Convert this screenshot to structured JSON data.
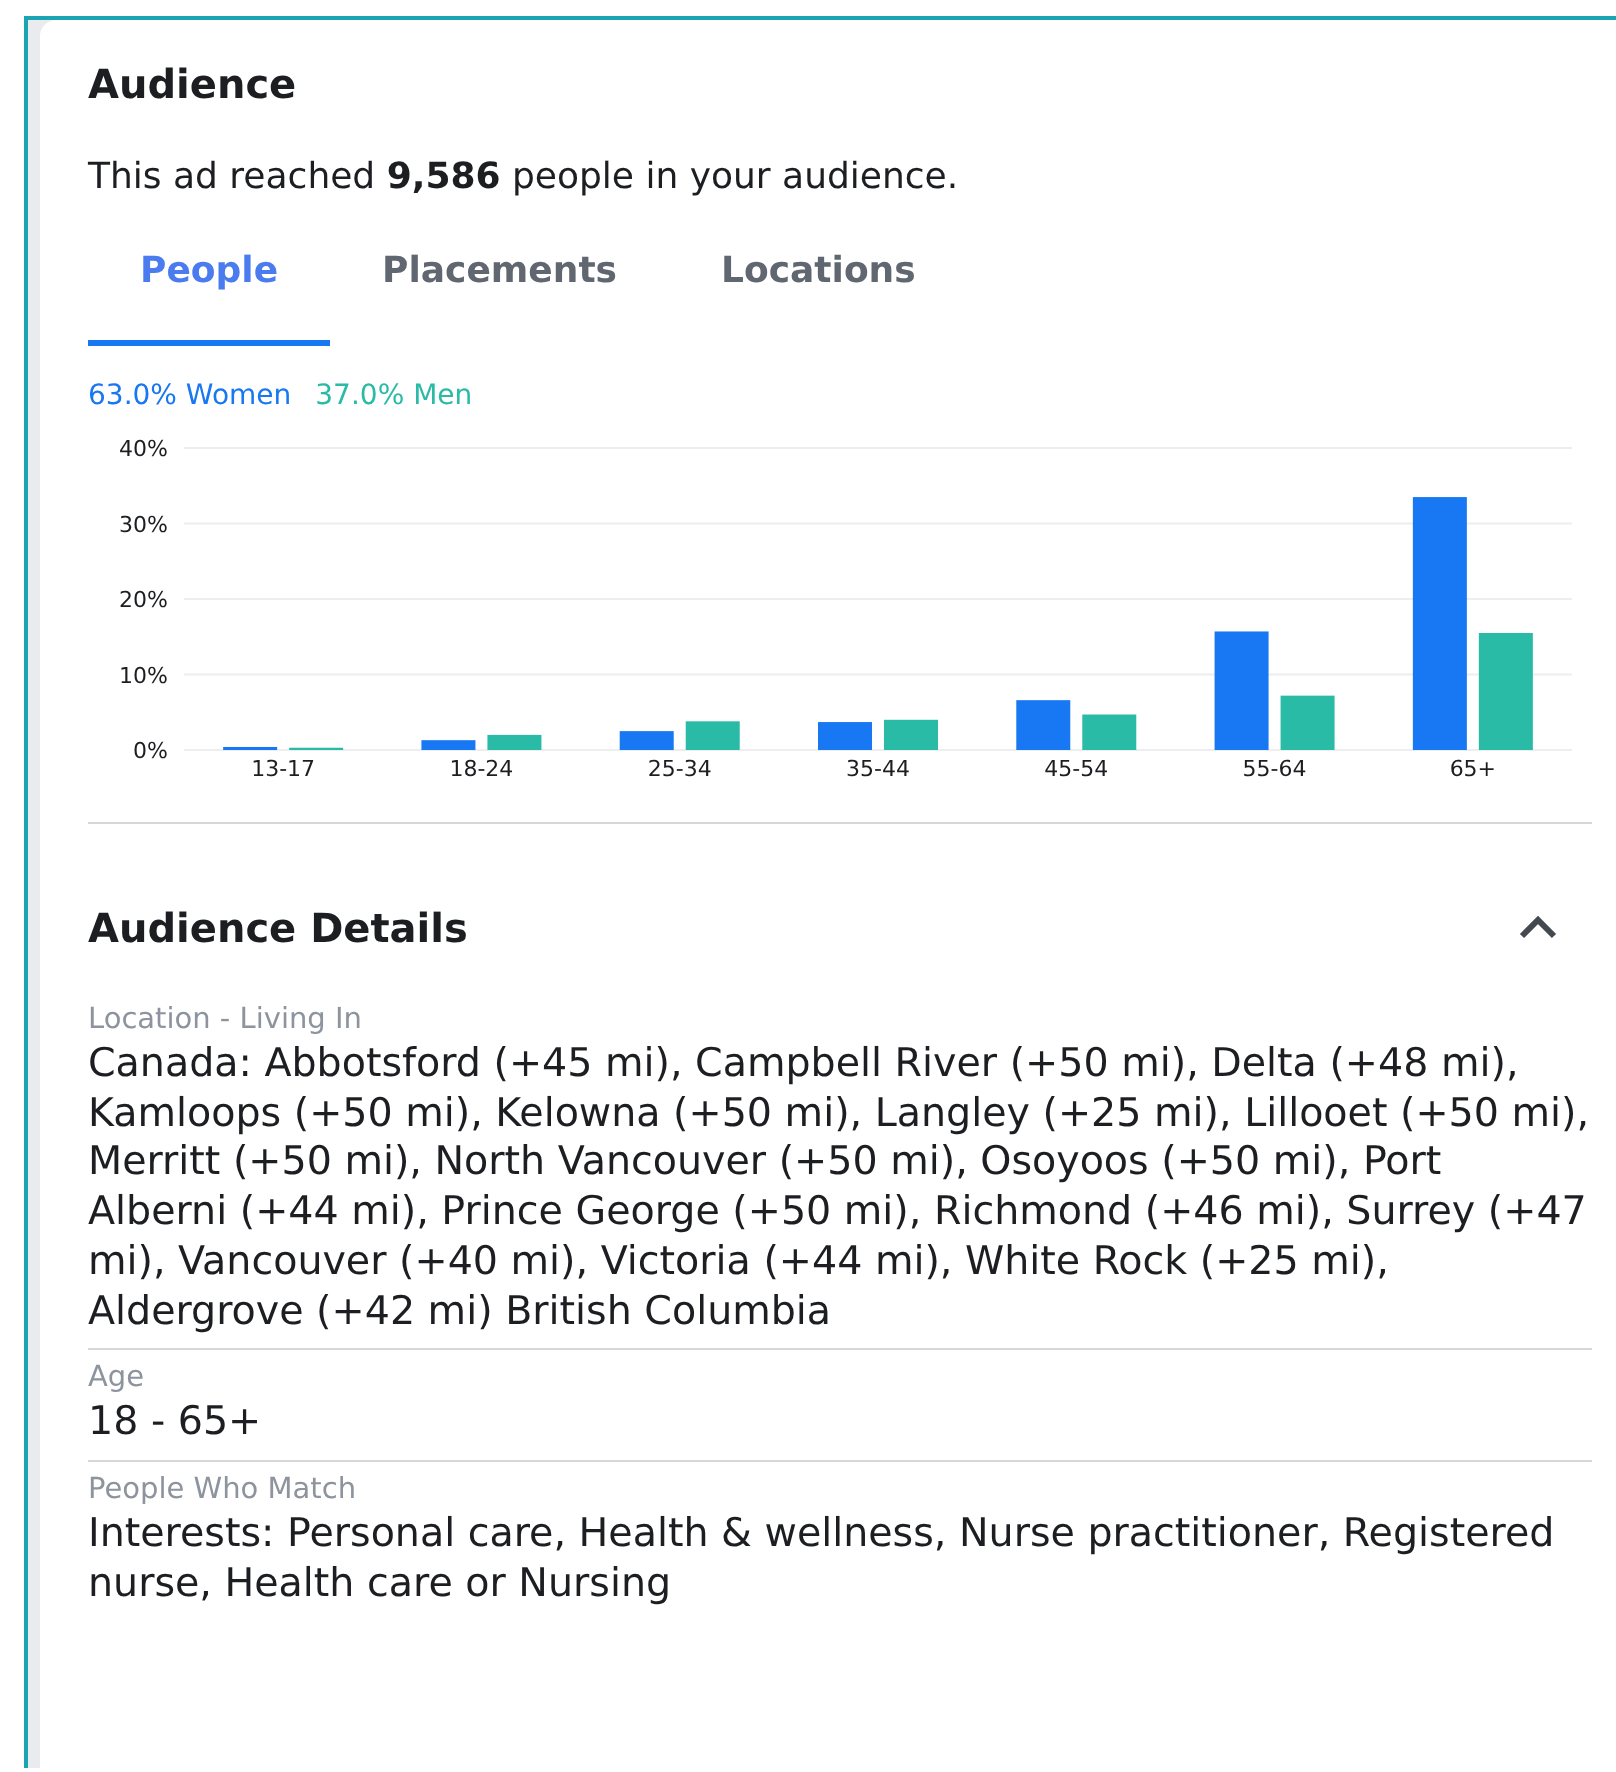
{
  "title": "Audience",
  "summary": "This ad reached **9,586** people in your audience.",
  "tabs": [
    {
      "label": "People",
      "selected": true
    },
    {
      "label": "Placements",
      "selected": false
    },
    {
      "label": "Locations",
      "selected": false
    }
  ],
  "legend": [
    {
      "share": "63.0%",
      "color": "#1877f2"
    },
    {
      "share": "37.0%",
      "color": "#2abba7"
    }
  ],
  "chart_data": {
    "type": "bar",
    "grid": true,
    "categories": [
      "13-17",
      "18-24",
      "25-34",
      "35-44",
      "45-54",
      "55-64",
      "65+"
    ],
    "ylim": [
      0,
      40
    ],
    "yticks": [
      {
        "value": 0,
        "label": "0%"
      },
      {
        "value": 10,
        "label": "10%"
      },
      {
        "value": 20,
        "label": "20%"
      },
      {
        "value": 30,
        "label": "30%"
      },
      {
        "value": 40,
        "label": "40%"
      }
    ],
    "series": [
      {
        "name": "Women",
        "color": "#1877f2",
        "values": [
          0.4,
          1.3,
          2.5,
          3.7,
          6.6,
          15.7,
          33.5
        ]
      },
      {
        "name": "Men",
        "color": "#2abba7",
        "values": [
          0.3,
          2,
          3.8,
          4,
          4.7,
          7.2,
          15.5
        ]
      }
    ]
  },
  "details": {
    "title": "Audience Details",
    "expanded": true,
    "items": [
      {
        "label": "Location - Living In",
        "value": "Canada: Abbotsford (+45 mi), Campbell River (+50 mi), Delta (+48 mi), Kamloops (+50 mi), Kelowna (+50 mi), Langley (+25 mi), Lillooet (+50 mi), Merritt (+50 mi), North Vancouver (+50 mi), Osoyoos (+50 mi), Port Alberni (+44 mi), Prince George (+50 mi), Richmond (+46 mi), Surrey (+47 mi), Vancouver (+40 mi), Victoria (+44 mi), White Rock (+25 mi), Aldergrove (+42 mi) British Columbia"
      },
      {
        "label": "Age",
        "value": "18 - 65+"
      },
      {
        "label": "People Who Match",
        "value": "Interests: Personal care, Health & wellness, Nurse practitioner, Registered nurse, Health care or Nursing"
      }
    ]
  }
}
